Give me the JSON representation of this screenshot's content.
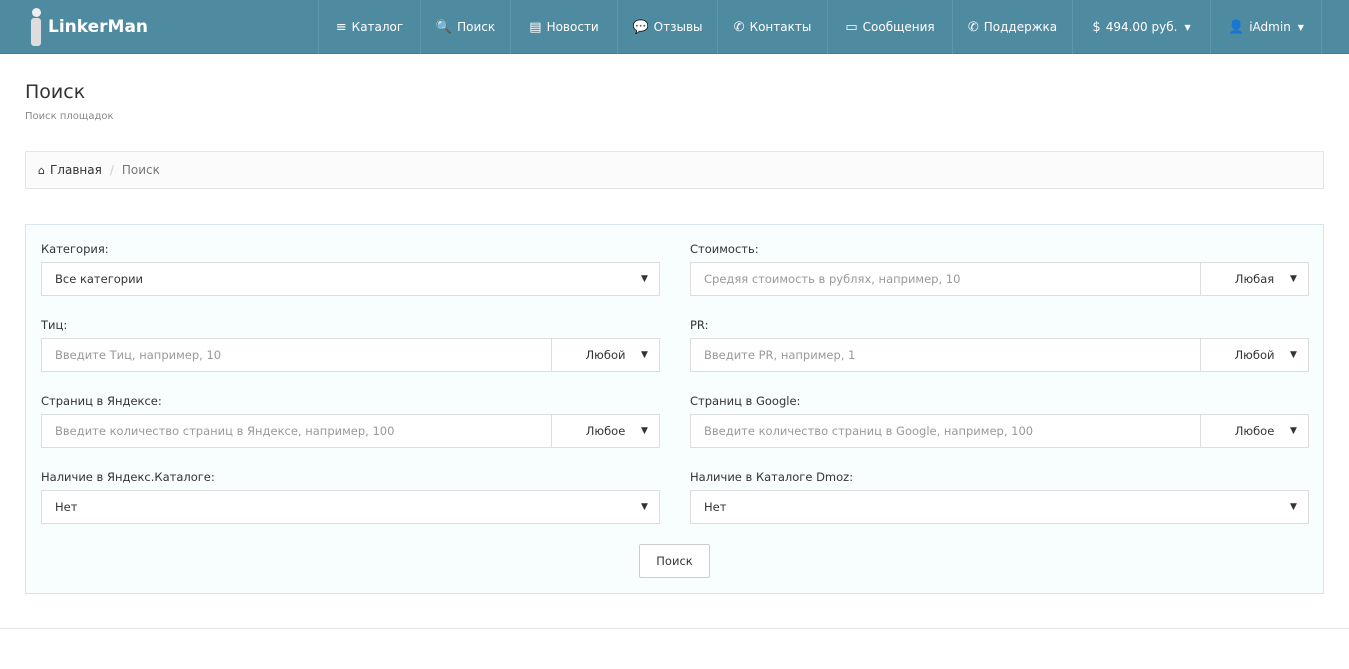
{
  "brand": "LinkerMan",
  "nav": [
    {
      "icon": "≡",
      "label": "Каталог",
      "name": "catalog",
      "w": 102
    },
    {
      "icon": "🔍",
      "label": "Поиск",
      "name": "search",
      "w": 90
    },
    {
      "icon": "▤",
      "label": "Новости",
      "name": "news",
      "w": 107
    },
    {
      "icon": "💬",
      "label": "Отзывы",
      "name": "reviews",
      "w": 100
    },
    {
      "icon": "✆",
      "label": "Контакты",
      "name": "contacts",
      "w": 110
    },
    {
      "icon": "▭",
      "label": "Сообщения",
      "name": "messages",
      "w": 125
    },
    {
      "icon": "✆",
      "label": "Поддержка",
      "name": "support",
      "w": 120
    },
    {
      "icon": "$",
      "label": "494.00 руб.",
      "name": "balance",
      "w": 138,
      "caret": true
    },
    {
      "icon": "👤",
      "label": "iAdmin",
      "name": "user",
      "w": 112,
      "caret": true
    }
  ],
  "page": {
    "title": "Поиск",
    "subtitle": "Поиск площадок"
  },
  "breadcrumb": {
    "home": "Главная",
    "current": "Поиск"
  },
  "form": {
    "category": {
      "label": "Категория:",
      "value": "Все категории"
    },
    "cost": {
      "label": "Стоимость:",
      "placeholder": "Средяя стоимость в рублях, например, 10",
      "select": "Любая"
    },
    "tic": {
      "label": "Тиц:",
      "placeholder": "Введите Тиц, например, 10",
      "select": "Любой"
    },
    "pr": {
      "label": "PR:",
      "placeholder": "Введите PR, например, 1",
      "select": "Любой"
    },
    "yandex_pages": {
      "label": "Страниц в Яндексе:",
      "placeholder": "Введите количество страниц в Яндексе, например, 100",
      "select": "Любое"
    },
    "google_pages": {
      "label": "Страниц в Google:",
      "placeholder": "Введите количество страниц в Google, например, 100",
      "select": "Любое"
    },
    "yandex_catalog": {
      "label": "Наличие в Яндекс.Каталоге:",
      "value": "Нет"
    },
    "dmoz": {
      "label": "Наличие в Каталоге Dmoz:",
      "value": "Нет"
    },
    "submit": "Поиск"
  }
}
